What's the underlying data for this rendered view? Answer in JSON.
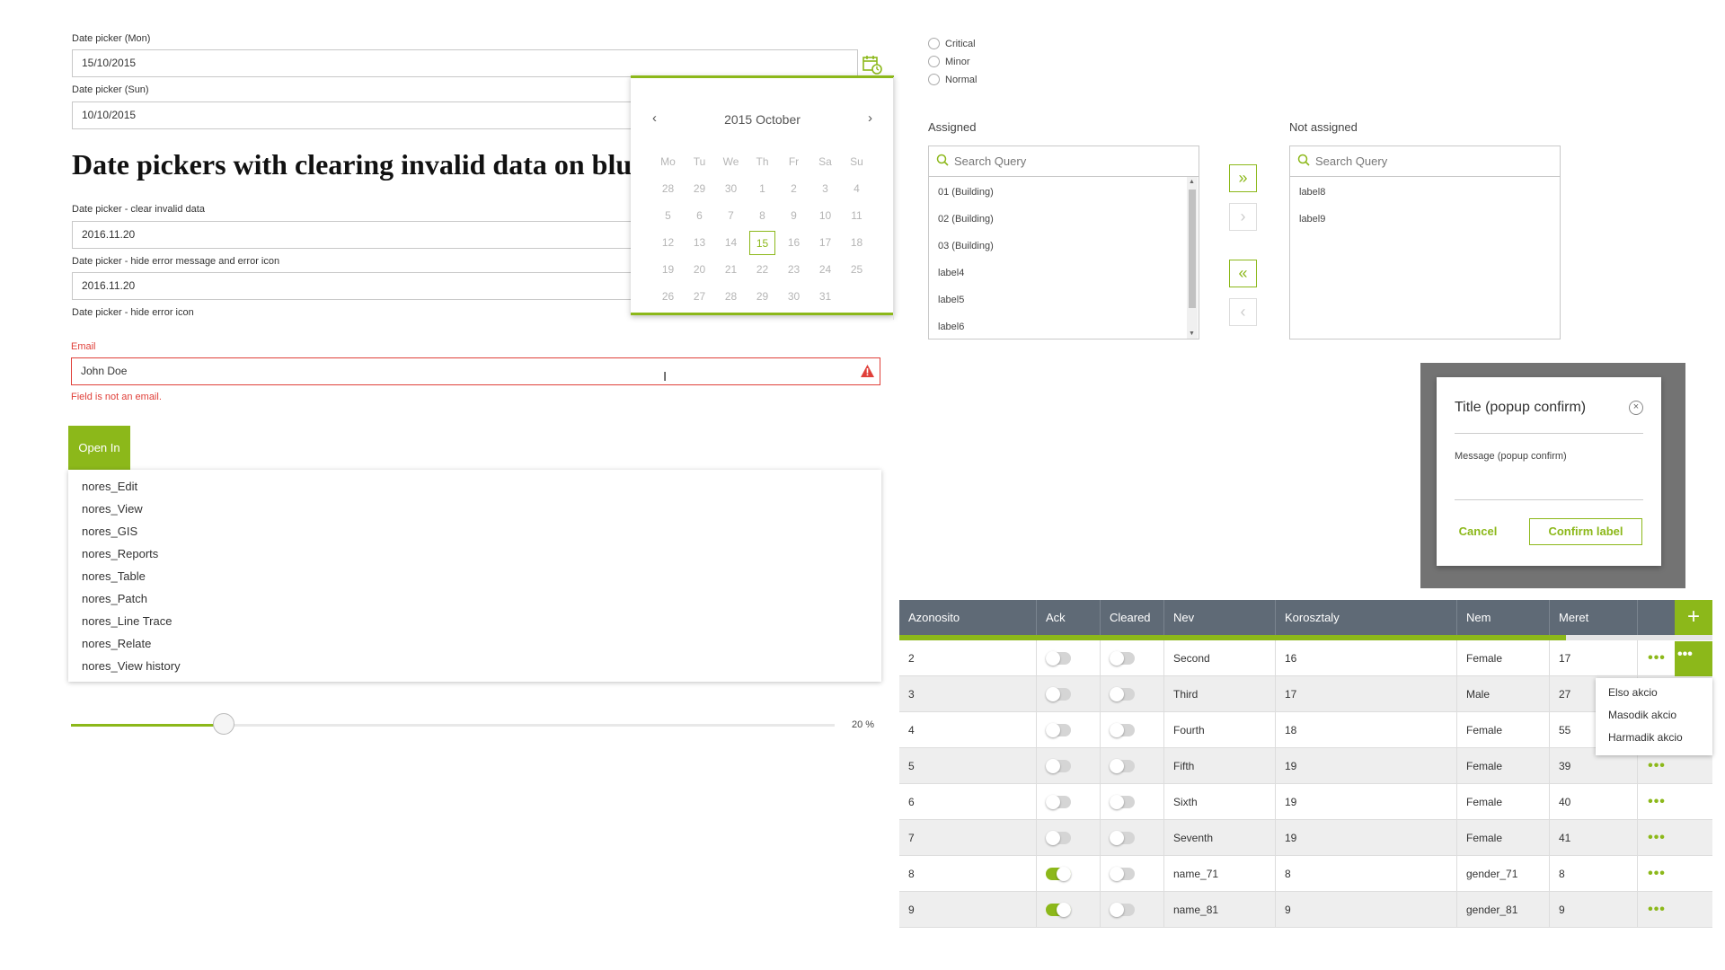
{
  "date_pickers": {
    "mon_label": "Date picker (Mon)",
    "mon_value": "15/10/2015",
    "sun_label": "Date picker (Sun)",
    "sun_value": "10/10/2015"
  },
  "calendar": {
    "title": "2015 October",
    "prev": "‹",
    "next": "›",
    "weekdays": [
      "Mo",
      "Tu",
      "We",
      "Th",
      "Fr",
      "Sa",
      "Su"
    ],
    "weeks": [
      [
        "28",
        "29",
        "30",
        "1",
        "2",
        "3",
        "4"
      ],
      [
        "5",
        "6",
        "7",
        "8",
        "9",
        "10",
        "11"
      ],
      [
        "12",
        "13",
        "14",
        "15",
        "16",
        "17",
        "18"
      ],
      [
        "19",
        "20",
        "21",
        "22",
        "23",
        "24",
        "25"
      ],
      [
        "26",
        "27",
        "28",
        "29",
        "30",
        "31",
        ""
      ]
    ],
    "selected": "15"
  },
  "clearing": {
    "heading": "Date pickers with clearing invalid data on blu",
    "clear_label": "Date picker - clear invalid data",
    "clear_value": "2016.11.20",
    "hide_msg_label": "Date picker - hide error message and error icon",
    "hide_msg_value": "2016.11.20",
    "hide_icon_label": "Date picker - hide error icon"
  },
  "email": {
    "label": "Email",
    "value": "John Doe",
    "error": "Field is not an email."
  },
  "open_in": {
    "button": "Open In",
    "items": [
      "nores_Edit",
      "nores_View",
      "nores_GIS",
      "nores_Reports",
      "nores_Table",
      "nores_Patch",
      "nores_Line Trace",
      "nores_Relate",
      "nores_View history"
    ]
  },
  "slider": {
    "value_pct": 20,
    "label": "20 %"
  },
  "severity": {
    "options": [
      "Critical",
      "Minor",
      "Normal"
    ]
  },
  "dual_list": {
    "assigned_label": "Assigned",
    "not_assigned_label": "Not assigned",
    "search_placeholder": "Search Query",
    "assigned_items": [
      "01 (Building)",
      "02 (Building)",
      "03 (Building)",
      "label4",
      "label5",
      "label6"
    ],
    "not_assigned_items": [
      "label8",
      "label9"
    ],
    "btn_all_right": "»",
    "btn_right": "›",
    "btn_all_left": "«",
    "btn_left": "‹"
  },
  "popup": {
    "title": "Title (popup confirm)",
    "message": "Message (popup confirm)",
    "cancel": "Cancel",
    "confirm": "Confirm label"
  },
  "table": {
    "columns": [
      "Azonosito",
      "Ack",
      "Cleared",
      "Nev",
      "Korosztaly",
      "Nem",
      "Meret"
    ],
    "add": "+",
    "progress": 0.82,
    "rows": [
      {
        "id": "2",
        "ack": false,
        "cleared": false,
        "nev": "Second",
        "kor": "16",
        "nem": "Female",
        "meret": "17"
      },
      {
        "id": "3",
        "ack": false,
        "cleared": false,
        "nev": "Third",
        "kor": "17",
        "nem": "Male",
        "meret": "27"
      },
      {
        "id": "4",
        "ack": false,
        "cleared": false,
        "nev": "Fourth",
        "kor": "18",
        "nem": "Female",
        "meret": "55"
      },
      {
        "id": "5",
        "ack": false,
        "cleared": false,
        "nev": "Fifth",
        "kor": "19",
        "nem": "Female",
        "meret": "39"
      },
      {
        "id": "6",
        "ack": false,
        "cleared": false,
        "nev": "Sixth",
        "kor": "19",
        "nem": "Female",
        "meret": "40"
      },
      {
        "id": "7",
        "ack": false,
        "cleared": false,
        "nev": "Seventh",
        "kor": "19",
        "nem": "Female",
        "meret": "41"
      },
      {
        "id": "8",
        "ack": true,
        "cleared": false,
        "nev": "name_71",
        "kor": "8",
        "nem": "gender_71",
        "meret": "8"
      },
      {
        "id": "9",
        "ack": true,
        "cleared": false,
        "nev": "name_81",
        "kor": "9",
        "nem": "gender_81",
        "meret": "9"
      }
    ],
    "row_menu": [
      "Elso akcio",
      "Masodik akcio",
      "Harmadik akcio"
    ]
  },
  "colors": {
    "accent": "#8cb81a",
    "error": "#e0403a",
    "header": "#5f6a76"
  }
}
